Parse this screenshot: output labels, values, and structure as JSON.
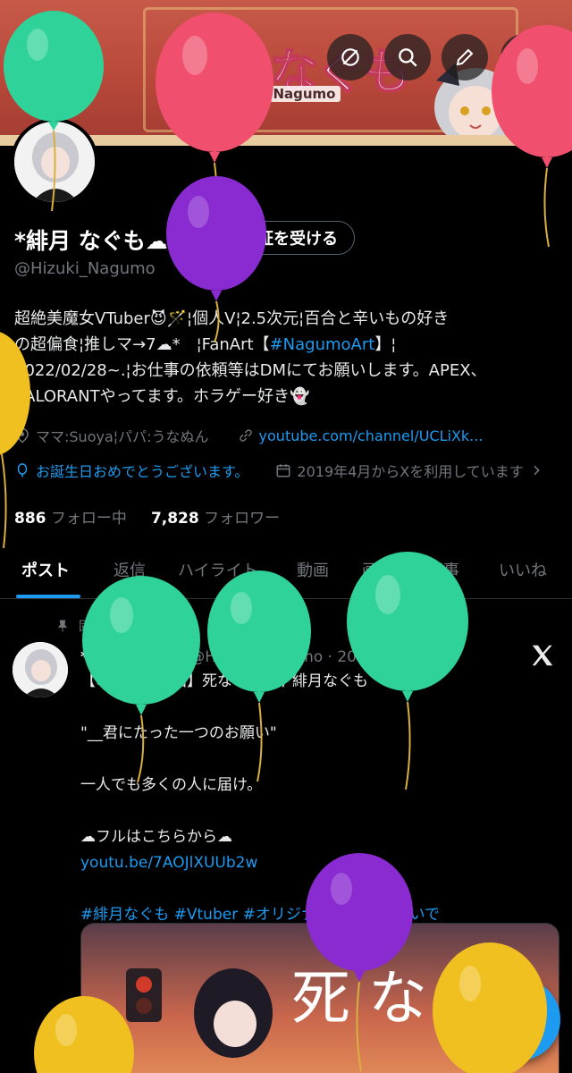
{
  "header": {
    "banner_logo": "緋月なぐも",
    "banner_logo_sub": "Hizuki Nagumo",
    "back_icon": "arrow-left-icon",
    "actions": [
      "mute-icon",
      "search-icon",
      "edit-icon",
      "share-icon"
    ]
  },
  "profile": {
    "display_name": "*緋月 なぐも☁",
    "verify_label": "認証を受ける",
    "handle": "@Hizuki_Nagumo",
    "bio_line1": "超絶美魔女VTuber😈🪄¦個人V¦2.5次元¦百合と辛いもの好き",
    "bio_line2a": "の超偏食¦推しマ→7☁*　¦FanArt【",
    "bio_hashtag": "#NagumoArt",
    "bio_line2b": "】¦",
    "bio_line3": "2022/02/28~.¦お仕事の依頼等はDMにてお願いします。APEX、",
    "bio_line4": "VALORANTやってます。ホラゲー好き👻",
    "location": "ママ:Suoya¦パパ:うなぬん",
    "website": "youtube.com/channel/UCLiXk...",
    "birthday": "お誕生日おめでとうございます。",
    "joined": "2019年4月からXを利用しています",
    "following_count": "886",
    "following_label": "フォロー中",
    "followers_count": "7,828",
    "followers_label": "フォロワー"
  },
  "tabs": [
    "ポスト",
    "返信",
    "ハイライト",
    "動画",
    "画像",
    "記事",
    "いいね"
  ],
  "post": {
    "pinned_label": "固定",
    "author": "*緋月 なぐも☁",
    "handle_date": "@Hizuki_Nagumo · 2023/02/28",
    "line1": "【オリジナル曲】死なないで / 緋月なぐも",
    "line2": "\"__君にたった一つのお願い\"",
    "line3": "一人でも多くの人に届け。",
    "line4": "☁フルはこちらから☁",
    "link": "youtu.be/7AOJlXUUb2w",
    "hashtags": "#緋月なぐも #Vtuber #オリジナル曲 #死なないで",
    "card_title": "死な"
  },
  "colors": {
    "accent": "#1d9bf0",
    "background": "#000000",
    "muted": "#71767b",
    "balloon_green": "#2fd39a",
    "balloon_pink": "#f0506e",
    "balloon_purple": "#8a2bd1",
    "balloon_yellow": "#f0c020"
  },
  "fab_icon": "plus-icon"
}
